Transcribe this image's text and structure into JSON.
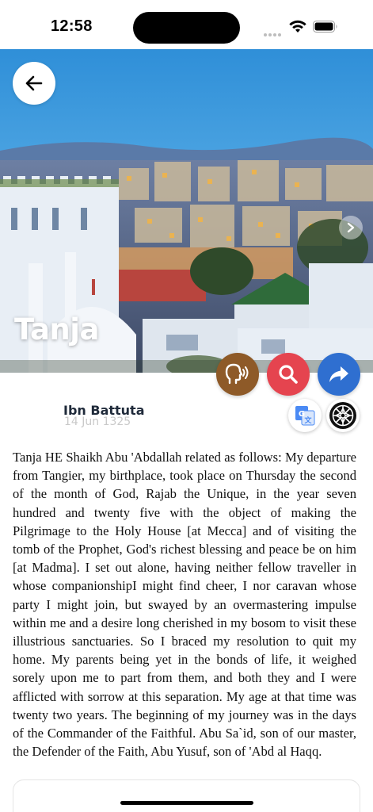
{
  "status_bar": {
    "time": "12:58",
    "icons": [
      "signal-dots-icon",
      "wifi-icon",
      "battery-icon"
    ]
  },
  "hero": {
    "title": "Tanja",
    "back_icon": "arrow-left-icon",
    "next_icon": "chevron-right-icon"
  },
  "actions": {
    "audio_icon": "speaking-head-icon",
    "search_icon": "search-icon",
    "share_icon": "share-arrow-icon",
    "translate_icon": "translate-icon",
    "pattern_icon": "star-pattern-icon",
    "colors": {
      "audio": "#8e5a28",
      "search": "#e5444f",
      "share": "#2f6fd0"
    }
  },
  "author": {
    "name": "Ibn Battuta",
    "date": "14 Jun 1325"
  },
  "article": {
    "text": "Tanja HE Shaikh Abu 'Abdallah related as follows: My departure from Tangier, my birthplace, took place on Thursday the second of the month of God, Rajab the Unique, in the year seven hundred and twenty five with the object of making the Pilgrimage to the Holy House [at Mecca] and of visiting the tomb of the Prophet, God's richest blessing and peace be on him [at Madma]. I set out alone, having neither fellow traveller in whose companionshipI might find cheer, I nor caravan whose party I might join, but swayed by an overmastering impulse within me and a desire long cherished in my bosom to visit these illustrious sanctuaries. So I braced my resolution to quit my home. My parents being yet in the bonds of life, it weighed sorely upon me to part from them, and both they and I were afflicted with sorrow at this separation. My age at that time was twenty two years. The beginning of my journey was in the days of the Commander of the Faithful. Abu Sa`id, son of our master, the Defender of the Faith, Abu Yusuf, son of 'Abd al Haqq."
  }
}
